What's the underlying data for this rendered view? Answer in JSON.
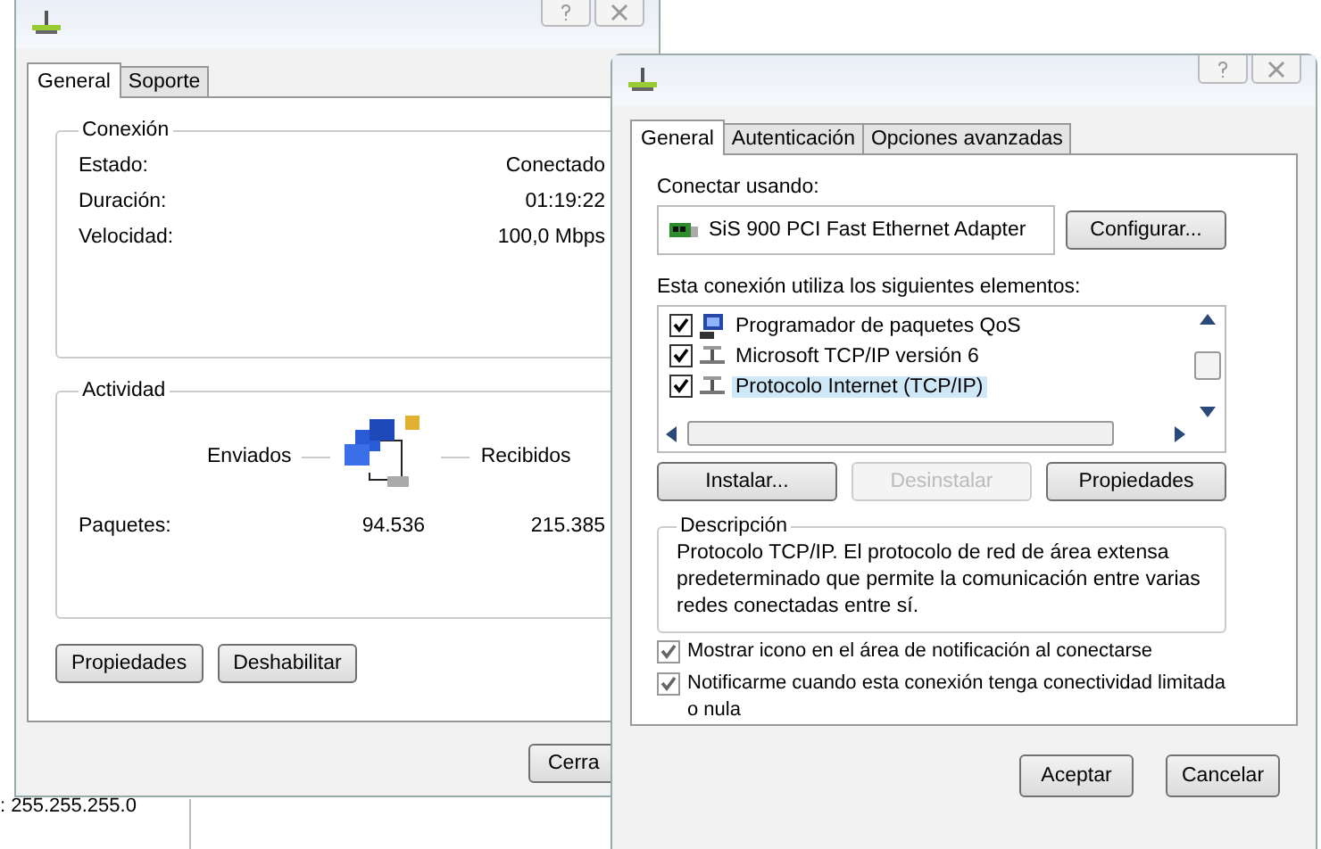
{
  "background_window": {
    "text": ": 255.255.255.0"
  },
  "status_window": {
    "tabs": [
      {
        "label": "General",
        "selected": true
      },
      {
        "label": "Soporte",
        "selected": false
      }
    ],
    "connection": {
      "title": "Conexión",
      "rows": [
        {
          "label": "Estado:",
          "value": "Conectado"
        },
        {
          "label": "Duración:",
          "value": "01:19:22"
        },
        {
          "label": "Velocidad:",
          "value": "100,0 Mbps"
        }
      ]
    },
    "activity": {
      "title": "Actividad",
      "sent_label": "Enviados",
      "received_label": "Recibidos",
      "packets_label": "Paquetes:",
      "sent": "94.536",
      "received": "215.385"
    },
    "buttons": [
      {
        "label": "Propiedades"
      },
      {
        "label": "Deshabilitar"
      }
    ],
    "close_button": "Cerra"
  },
  "properties_window": {
    "tabs": [
      {
        "label": "General",
        "selected": true
      },
      {
        "label": "Autenticación",
        "selected": false
      },
      {
        "label": "Opciones avanzadas",
        "selected": false
      }
    ],
    "connect_using_label": "Conectar usando:",
    "adapter": "SiS 900 PCI Fast Ethernet Adapter",
    "configure_button": "Configurar...",
    "items_label": "Esta conexión utiliza los siguientes elementos:",
    "items": [
      {
        "label": "Programador de paquetes QoS",
        "kind": "scheduler",
        "checked": true,
        "selected": false
      },
      {
        "label": "Microsoft TCP/IP versión 6",
        "kind": "protocol",
        "checked": true,
        "selected": false
      },
      {
        "label": "Protocolo Internet (TCP/IP)",
        "kind": "protocol",
        "checked": true,
        "selected": true
      }
    ],
    "buttons": [
      {
        "label": "Instalar...",
        "disabled": false
      },
      {
        "label": "Desinstalar",
        "disabled": true
      },
      {
        "label": "Propiedades",
        "disabled": false
      }
    ],
    "description": {
      "title": "Descripción",
      "text": "Protocolo TCP/IP. El protocolo de red de área extensa predeterminado que permite la comunicación entre varias redes conectadas entre sí."
    },
    "options": [
      {
        "label": "Mostrar icono en el área de notificación al conectarse",
        "checked": true
      },
      {
        "label": "Notificarme cuando esta conexión tenga conectividad limitada o nula",
        "checked": true
      }
    ],
    "footer_buttons": [
      "Aceptar",
      "Cancelar"
    ]
  }
}
